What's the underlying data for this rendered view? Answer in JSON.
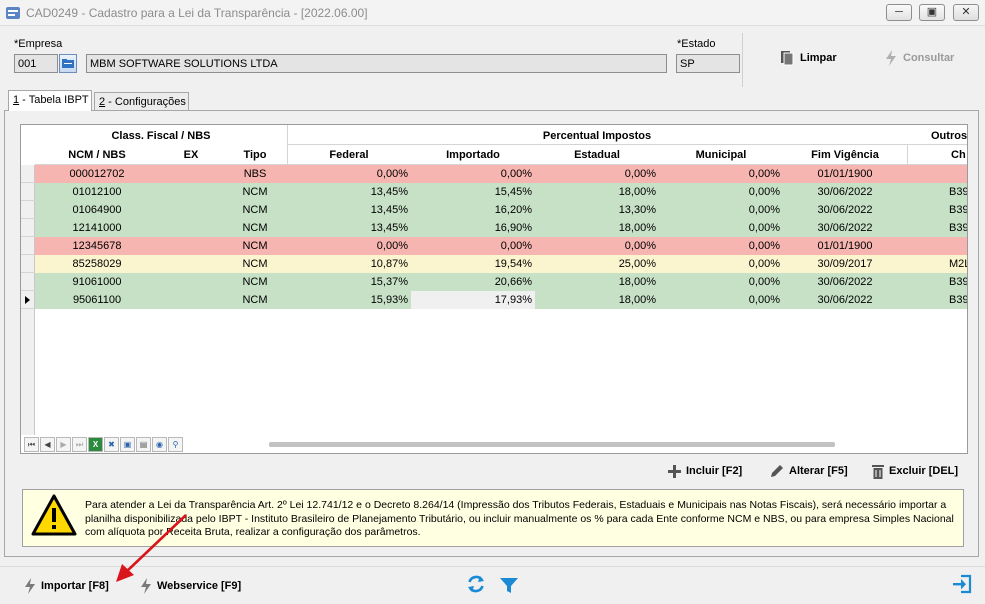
{
  "window": {
    "title": "CAD0249 - Cadastro para a Lei da Transparência - [2022.06.00]",
    "minimize_icon": "minimize-icon",
    "maximize_icon": "maximize-icon",
    "close_icon": "close-icon"
  },
  "form": {
    "empresa_label": "Empresa",
    "empresa_code": "001",
    "empresa_name": "MBM SOFTWARE SOLUTIONS LTDA",
    "estado_label": "Estado",
    "estado_value": "SP",
    "required_marker": "*"
  },
  "toolbar": {
    "limpar_label": "Limpar",
    "consultar_label": "Consultar"
  },
  "tabs": [
    {
      "num": "1",
      "label": " - Tabela IBPT"
    },
    {
      "num": "2",
      "label": " - Configurações"
    }
  ],
  "grid": {
    "group_headers": {
      "class_fiscal": "Class. Fiscal / NBS",
      "percentual": "Percentual Impostos",
      "outros": "Outros"
    },
    "columns": [
      "NCM / NBS",
      "EX",
      "Tipo",
      "Federal",
      "Importado",
      "Estadual",
      "Municipal",
      "Fim Vigência",
      "Ch"
    ],
    "rows": [
      {
        "ncm": "000012702",
        "ex": "",
        "tipo": "NBS",
        "federal": "0,00%",
        "importado": "0,00%",
        "estadual": "0,00%",
        "municipal": "0,00%",
        "fim": "01/01/1900",
        "ch": "",
        "color": "red"
      },
      {
        "ncm": "01012100",
        "ex": "",
        "tipo": "NCM",
        "federal": "13,45%",
        "importado": "15,45%",
        "estadual": "18,00%",
        "municipal": "0,00%",
        "fim": "30/06/2022",
        "ch": "B39",
        "color": "green"
      },
      {
        "ncm": "01064900",
        "ex": "",
        "tipo": "NCM",
        "federal": "13,45%",
        "importado": "16,20%",
        "estadual": "13,30%",
        "municipal": "0,00%",
        "fim": "30/06/2022",
        "ch": "B39",
        "color": "green"
      },
      {
        "ncm": "12141000",
        "ex": "",
        "tipo": "NCM",
        "federal": "13,45%",
        "importado": "16,90%",
        "estadual": "18,00%",
        "municipal": "0,00%",
        "fim": "30/06/2022",
        "ch": "B39",
        "color": "green"
      },
      {
        "ncm": "12345678",
        "ex": "",
        "tipo": "NCM",
        "federal": "0,00%",
        "importado": "0,00%",
        "estadual": "0,00%",
        "municipal": "0,00%",
        "fim": "01/01/1900",
        "ch": "",
        "color": "red"
      },
      {
        "ncm": "85258029",
        "ex": "",
        "tipo": "NCM",
        "federal": "10,87%",
        "importado": "19,54%",
        "estadual": "25,00%",
        "municipal": "0,00%",
        "fim": "30/09/2017",
        "ch": "M2L",
        "color": "yellow"
      },
      {
        "ncm": "91061000",
        "ex": "",
        "tipo": "NCM",
        "federal": "15,37%",
        "importado": "20,66%",
        "estadual": "18,00%",
        "municipal": "0,00%",
        "fim": "30/06/2022",
        "ch": "B39",
        "color": "green"
      },
      {
        "ncm": "95061100",
        "ex": "",
        "tipo": "NCM",
        "federal": "15,93%",
        "importado": "17,93%",
        "estadual": "18,00%",
        "municipal": "0,00%",
        "fim": "30/06/2022",
        "ch": "B39",
        "color": "green",
        "current": true
      }
    ],
    "navigator_icons": [
      "first-record-icon",
      "prior-record-icon",
      "next-record-icon",
      "last-record-icon",
      "excel-export-icon",
      "tools-icon",
      "save-icon",
      "grid-config-icon",
      "refresh-grid-icon",
      "search-icon"
    ]
  },
  "grid_actions": {
    "incluir": "Incluir [F2]",
    "alterar": "Alterar [F5]",
    "excluir": "Excluir [DEL]"
  },
  "warning": {
    "text": "Para atender a Lei da Transparência Art. 2º Lei 12.741/12 e o Decreto 8.264/14 (Impressão dos Tributos Federais, Estaduais e Municipais nas Notas Fiscais), será necessário importar a planilha disponibilizada pelo IBPT - Instituto Brasileiro de Planejamento Tributário, ou incluir manualmente os % para cada Ente conforme NCM e NBS, ou para empresa Simples Nacional com alíquota por Receita Bruta, realizar a configuração dos parâmetros.",
    "icon": "warning-icon"
  },
  "bottom": {
    "importar": "Importar [F8]",
    "webservice": "Webservice [F9]",
    "refresh_icon": "refresh-icon",
    "filter_icon": "filter-icon",
    "exit_icon": "exit-icon"
  },
  "colors": {
    "row_red": "#f6b5b0",
    "row_green": "#c7e1c7",
    "row_yellow": "#fbf5cf",
    "accent_blue": "#1a8ad4",
    "annotation_red": "#d9141a"
  }
}
